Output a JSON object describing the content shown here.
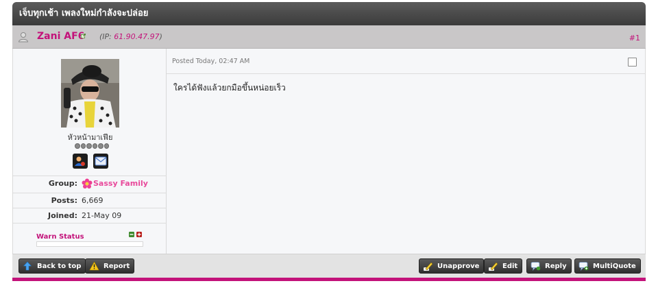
{
  "post": {
    "thread_title": "เจ็บทุกเช้า เพลงใหม่กำลังจะปล่อย",
    "author": "Zani AF6",
    "ip_prefix": "(IP: ",
    "ip": "61.90.47.97",
    "ip_suffix": ")",
    "post_number": "#1",
    "posted": "Posted Today, 02:47 AM",
    "body": "ใครได้ฟังแล้วยกมือขึ้นหน่อยเร็ว"
  },
  "profile": {
    "title": "หัวหน้ามาเฟีย",
    "group_label": "Group:",
    "group": "Sassy Family",
    "posts_label": "Posts:",
    "posts": "6,669",
    "joined_label": "Joined:",
    "joined": "21-May 09",
    "warn_label": "Warn Status"
  },
  "buttons": {
    "back_to_top": "Back to top",
    "report": "Report",
    "unapprove": "Unapprove",
    "edit": "Edit",
    "reply": "Reply",
    "multiquote": "MultiQuote"
  },
  "icons": {
    "user": "user-icon",
    "external": "external-link-icon",
    "profile": "profile-card-icon",
    "message": "envelope-icon",
    "group": "flower-icon",
    "warn_down": "minus-icon",
    "warn_up": "plus-icon",
    "back_to_top": "arrow-up-icon",
    "report": "warning-icon",
    "unapprove": "pen-icon",
    "edit": "pencil-icon",
    "reply": "speech-bubble-icon",
    "multiquote": "quote-plus-icon"
  },
  "colors": {
    "accent": "#c3127a",
    "group": "#e8499b",
    "titlebar": "#3b3b3b",
    "authorbar": "#c9c7c8"
  }
}
